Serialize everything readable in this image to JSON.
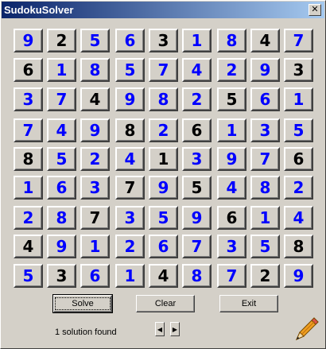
{
  "window": {
    "title": "SudokuSolver",
    "close_glyph": "✕"
  },
  "grid": [
    [
      {
        "v": "9",
        "g": false
      },
      {
        "v": "2",
        "g": true
      },
      {
        "v": "5",
        "g": false
      },
      {
        "v": "6",
        "g": false
      },
      {
        "v": "3",
        "g": true
      },
      {
        "v": "1",
        "g": false
      },
      {
        "v": "8",
        "g": false
      },
      {
        "v": "4",
        "g": true
      },
      {
        "v": "7",
        "g": false
      }
    ],
    [
      {
        "v": "6",
        "g": true
      },
      {
        "v": "1",
        "g": false
      },
      {
        "v": "8",
        "g": false
      },
      {
        "v": "5",
        "g": false
      },
      {
        "v": "7",
        "g": false
      },
      {
        "v": "4",
        "g": false
      },
      {
        "v": "2",
        "g": false
      },
      {
        "v": "9",
        "g": false
      },
      {
        "v": "3",
        "g": true
      }
    ],
    [
      {
        "v": "3",
        "g": false
      },
      {
        "v": "7",
        "g": false
      },
      {
        "v": "4",
        "g": true
      },
      {
        "v": "9",
        "g": false
      },
      {
        "v": "8",
        "g": false
      },
      {
        "v": "2",
        "g": false
      },
      {
        "v": "5",
        "g": true
      },
      {
        "v": "6",
        "g": false
      },
      {
        "v": "1",
        "g": false
      }
    ],
    [
      {
        "v": "7",
        "g": false
      },
      {
        "v": "4",
        "g": false
      },
      {
        "v": "9",
        "g": false
      },
      {
        "v": "8",
        "g": true
      },
      {
        "v": "2",
        "g": false
      },
      {
        "v": "6",
        "g": true
      },
      {
        "v": "1",
        "g": false
      },
      {
        "v": "3",
        "g": false
      },
      {
        "v": "5",
        "g": false
      }
    ],
    [
      {
        "v": "8",
        "g": true
      },
      {
        "v": "5",
        "g": false
      },
      {
        "v": "2",
        "g": false
      },
      {
        "v": "4",
        "g": false
      },
      {
        "v": "1",
        "g": true
      },
      {
        "v": "3",
        "g": false
      },
      {
        "v": "9",
        "g": false
      },
      {
        "v": "7",
        "g": false
      },
      {
        "v": "6",
        "g": true
      }
    ],
    [
      {
        "v": "1",
        "g": false
      },
      {
        "v": "6",
        "g": false
      },
      {
        "v": "3",
        "g": false
      },
      {
        "v": "7",
        "g": true
      },
      {
        "v": "9",
        "g": false
      },
      {
        "v": "5",
        "g": true
      },
      {
        "v": "4",
        "g": false
      },
      {
        "v": "8",
        "g": false
      },
      {
        "v": "2",
        "g": false
      }
    ],
    [
      {
        "v": "2",
        "g": false
      },
      {
        "v": "8",
        "g": false
      },
      {
        "v": "7",
        "g": true
      },
      {
        "v": "3",
        "g": false
      },
      {
        "v": "5",
        "g": false
      },
      {
        "v": "9",
        "g": false
      },
      {
        "v": "6",
        "g": true
      },
      {
        "v": "1",
        "g": false
      },
      {
        "v": "4",
        "g": false
      }
    ],
    [
      {
        "v": "4",
        "g": true
      },
      {
        "v": "9",
        "g": false
      },
      {
        "v": "1",
        "g": false
      },
      {
        "v": "2",
        "g": false
      },
      {
        "v": "6",
        "g": false
      },
      {
        "v": "7",
        "g": false
      },
      {
        "v": "3",
        "g": false
      },
      {
        "v": "5",
        "g": false
      },
      {
        "v": "8",
        "g": true
      }
    ],
    [
      {
        "v": "5",
        "g": false
      },
      {
        "v": "3",
        "g": true
      },
      {
        "v": "6",
        "g": false
      },
      {
        "v": "1",
        "g": false
      },
      {
        "v": "4",
        "g": true
      },
      {
        "v": "8",
        "g": false
      },
      {
        "v": "7",
        "g": false
      },
      {
        "v": "2",
        "g": true
      },
      {
        "v": "9",
        "g": false
      }
    ]
  ],
  "colors": {
    "given": "#000000",
    "solved": "#0000ff",
    "face": "#d4d0c8"
  },
  "buttons": {
    "solve": "Solve",
    "clear": "Clear",
    "exit": "Exit"
  },
  "status": "1 solution found",
  "spinner": {
    "left_glyph": "◀",
    "right_glyph": "▶"
  },
  "icons": {
    "edit": "pencil-icon"
  }
}
